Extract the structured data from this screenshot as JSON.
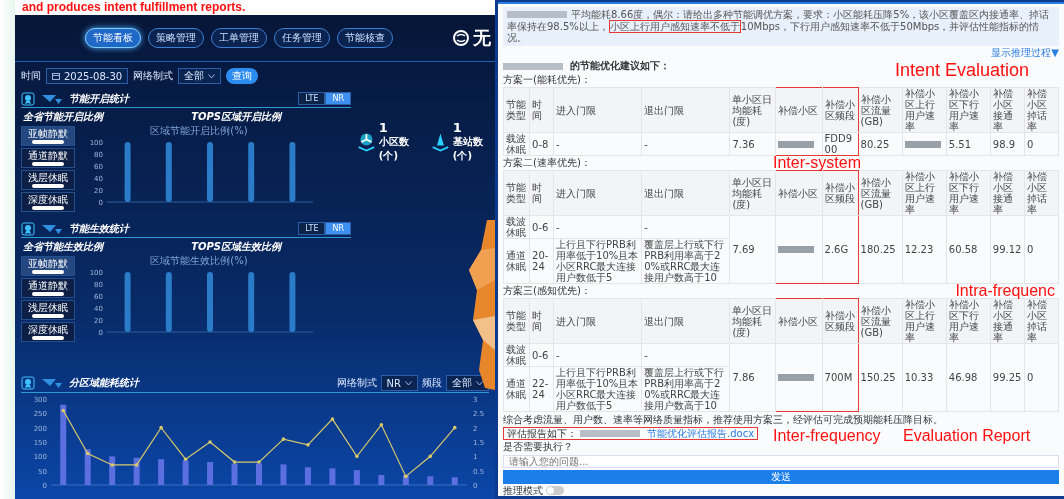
{
  "caption": "and produces intent fulfillment reports.",
  "dashboard": {
    "nav_tabs": [
      {
        "label": "节能看板",
        "selected": true
      },
      {
        "label": "策略管理",
        "selected": false
      },
      {
        "label": "工单管理",
        "selected": false
      },
      {
        "label": "任务管理",
        "selected": false
      },
      {
        "label": "节能核查",
        "selected": false
      }
    ],
    "logo_text": "无",
    "filters": {
      "date_label": "时间",
      "date_value": "2025-08-30",
      "network_label": "网络制式",
      "network_value": "全部",
      "query_button": "查询"
    },
    "sections": [
      {
        "title": "节能开启统计",
        "toggle": [
          {
            "label": "LTE",
            "selected": false
          },
          {
            "label": "NR",
            "selected": true
          }
        ],
        "province_title": "全省节能开启比例",
        "region_title": "TOPS区域开启比例",
        "cards": [
          {
            "label": "亚帧静默",
            "selected": true
          },
          {
            "label": "通道静默",
            "selected": false
          },
          {
            "label": "浅层休眠",
            "selected": false
          },
          {
            "label": "深度休眠",
            "selected": false
          }
        ],
        "chart_data": {
          "type": "bar",
          "title": "区域节能开启比例(%)",
          "values": [
            100,
            100,
            100,
            100,
            100
          ],
          "ylim": [
            0,
            100
          ],
          "yticks": [
            0,
            20,
            40,
            60,
            80,
            100
          ]
        }
      },
      {
        "title": "节能生效统计",
        "toggle": [
          {
            "label": "LTE",
            "selected": false
          },
          {
            "label": "NR",
            "selected": true
          }
        ],
        "province_title": "全省节能生效比例",
        "region_title": "TOPS区域生效比例",
        "cards": [
          {
            "label": "亚帧静默",
            "selected": true
          },
          {
            "label": "通道静默",
            "selected": false
          },
          {
            "label": "浅层休眠",
            "selected": false
          },
          {
            "label": "深度休眠",
            "selected": false
          }
        ],
        "chart_data": {
          "type": "bar",
          "title": "区域节能生效比例(%)",
          "values": [
            100,
            100,
            100,
            100,
            100
          ],
          "ylim": [
            0,
            100
          ],
          "yticks": [
            0,
            20,
            40,
            60,
            80,
            100
          ]
        }
      }
    ],
    "stats": [
      {
        "value": "1",
        "label": "小区数(个)"
      },
      {
        "value": "1",
        "label": "基站数(个)"
      }
    ],
    "energy": {
      "title": "分区域能耗统计",
      "network_label": "网络制式",
      "network_value": "NR",
      "band_label": "频段",
      "band_value": "全部",
      "chart_data": {
        "type": "bar",
        "ylim": [
          0,
          300
        ],
        "yticks": [
          0,
          50,
          100,
          150,
          200,
          250,
          300
        ],
        "y2lim": [
          0,
          3
        ],
        "y2ticks": [
          0,
          0.5,
          1,
          1.5,
          2,
          2.5,
          3
        ],
        "series": [
          {
            "color": "#5b6fe0",
            "values": [
              280,
              125,
              100,
              95,
              90,
              85,
              80,
              75,
              75,
              72,
              62,
              58,
              52,
              35,
              35,
              30,
              27
            ]
          },
          {
            "type": "line",
            "axis": "y2",
            "color": "#d8c96a",
            "values": [
              2.6,
              1.1,
              0.7,
              0.7,
              2.0,
              0.9,
              1.5,
              0.8,
              0.8,
              1.6,
              1.4,
              2.3,
              1.0,
              2.1,
              0.3,
              1.0,
              2.0
            ]
          }
        ]
      }
    }
  },
  "chat": {
    "prompt": {
      "text_before": "平均能耗8.66度，偶尔：请给出多种节能调优方案，要求：小区能耗压降5%，该小区覆盖区内接通率、掉话率保持在98.5%以上，",
      "highlight": "小区上行用户感知速率不低于",
      "text_after": "10Mbps，下行用户感知速率不低于50Mbps，并评估性能指标的情况。"
    },
    "show_reasoning": "显示推理过程▼",
    "intro": "的节能优化建议如下：",
    "schemes": [
      {
        "title": "方案一(能耗优先)：",
        "columns": [
          {
            "label": "节能类型",
            "highlighted": false
          },
          {
            "label": "时间",
            "highlighted": false
          },
          {
            "label": "进入门限",
            "highlighted": false
          },
          {
            "label": "退出门限",
            "highlighted": false
          },
          {
            "label": "单小区日均能耗(度)",
            "highlighted": false
          },
          {
            "label": "补偿小区",
            "highlighted": true
          },
          {
            "label": "补偿小区频段",
            "highlighted": true
          },
          {
            "label": "补偿小区流量(GB)",
            "highlighted": false
          },
          {
            "label": "补偿小区上行用户速率",
            "highlighted": false
          },
          {
            "label": "补偿小区下行用户速率",
            "highlighted": false
          },
          {
            "label": "补偿小区接通率",
            "highlighted": false
          },
          {
            "label": "补偿小区掉话率",
            "highlighted": false
          }
        ],
        "rows": [
          [
            "载波休眠",
            "0-8",
            "-",
            "-"
          ]
        ],
        "shared": [
          {
            "kind": "text",
            "value": "7.36"
          },
          {
            "kind": "redacted"
          },
          {
            "kind": "text",
            "value": "FDD900"
          },
          {
            "kind": "text",
            "value": "80.25"
          },
          {
            "kind": "redacted"
          },
          {
            "kind": "text",
            "value": "5.51"
          },
          {
            "kind": "text",
            "value": "98.9"
          },
          {
            "kind": "text",
            "value": "0"
          }
        ]
      },
      {
        "title": "方案二(速率优先)：",
        "columns": [
          {
            "label": "节能类型",
            "highlighted": false
          },
          {
            "label": "时间",
            "highlighted": false
          },
          {
            "label": "进入门限",
            "highlighted": false
          },
          {
            "label": "退出门限",
            "highlighted": false
          },
          {
            "label": "单小区日均能耗(度)",
            "highlighted": false
          },
          {
            "label": "补偿小区",
            "highlighted": true
          },
          {
            "label": "补偿小区频段",
            "highlighted": true
          },
          {
            "label": "补偿小区流量(GB)",
            "highlighted": false
          },
          {
            "label": "补偿小区上行用户速率",
            "highlighted": false
          },
          {
            "label": "补偿小区下行用户速率",
            "highlighted": false
          },
          {
            "label": "补偿小区接通率",
            "highlighted": false
          },
          {
            "label": "补偿小区掉话率",
            "highlighted": false
          }
        ],
        "rows": [
          [
            "载波休眠",
            "0-6",
            "-",
            "-"
          ],
          [
            "通道休眠",
            "20-24",
            "上行且下行PRB利用率低于10%且本小区RRC最大连接用户数低于5",
            "覆盖层上行或下行PRB利用率高于20%或RRC最大连接用户数高于10"
          ]
        ],
        "shared": [
          {
            "kind": "text",
            "value": "7.69"
          },
          {
            "kind": "redacted"
          },
          {
            "kind": "text",
            "value": "2.6G"
          },
          {
            "kind": "text",
            "value": "180.25"
          },
          {
            "kind": "text",
            "value": "12.23"
          },
          {
            "kind": "text",
            "value": "60.58"
          },
          {
            "kind": "text",
            "value": "99.12"
          },
          {
            "kind": "text",
            "value": "0"
          }
        ]
      },
      {
        "title": "方案三(感知优先)：",
        "columns": [
          {
            "label": "节能类型",
            "highlighted": false
          },
          {
            "label": "时间",
            "highlighted": false
          },
          {
            "label": "进入门限",
            "highlighted": false
          },
          {
            "label": "退出门限",
            "highlighted": false
          },
          {
            "label": "单小区日均能耗(度)",
            "highlighted": false
          },
          {
            "label": "补偿小区",
            "highlighted": true
          },
          {
            "label": "补偿小区频段",
            "highlighted": true
          },
          {
            "label": "补偿小区流量(GB)",
            "highlighted": false
          },
          {
            "label": "补偿小区上行用户速率",
            "highlighted": false
          },
          {
            "label": "补偿小区下行用户速率",
            "highlighted": false
          },
          {
            "label": "补偿小区接通率",
            "highlighted": false
          },
          {
            "label": "补偿小区掉话率",
            "highlighted": false
          }
        ],
        "rows": [
          [
            "载波休眠",
            "0-6",
            "-",
            "-"
          ],
          [
            "通道休眠",
            "22-24",
            "上行且下行PRB利用率低于10%且本小区RRC最大连接用户数低于5",
            "覆盖层上行或下行PRB利用率高于20%或RRC最大连接用户数高于10"
          ]
        ],
        "shared": [
          {
            "kind": "text",
            "value": "7.86"
          },
          {
            "kind": "redacted"
          },
          {
            "kind": "text",
            "value": "700M"
          },
          {
            "kind": "text",
            "value": "150.25"
          },
          {
            "kind": "text",
            "value": "10.33"
          },
          {
            "kind": "text",
            "value": "46.98"
          },
          {
            "kind": "text",
            "value": "99.25"
          },
          {
            "kind": "text",
            "value": "0"
          }
        ]
      }
    ],
    "summary": "综合考虑流量、用户数、速率等网络质量指标，推荐使用方案三，经评估可完成预期能耗压降目标。",
    "report": {
      "label": "评估报告如下：",
      "link": "节能优化评估报告.docx",
      "highlighted": true
    },
    "confirm": "是否需要执行？",
    "input": {
      "placeholder": "请输入您的问题..."
    },
    "send_button": "发送",
    "reasoning_toggle": {
      "label": "推理模式",
      "on": false
    }
  },
  "annotations": [
    "Intent Evaluation",
    "Inter-system",
    "Intra-frequenc",
    "Inter-frequency",
    "Evaluation Report"
  ]
}
